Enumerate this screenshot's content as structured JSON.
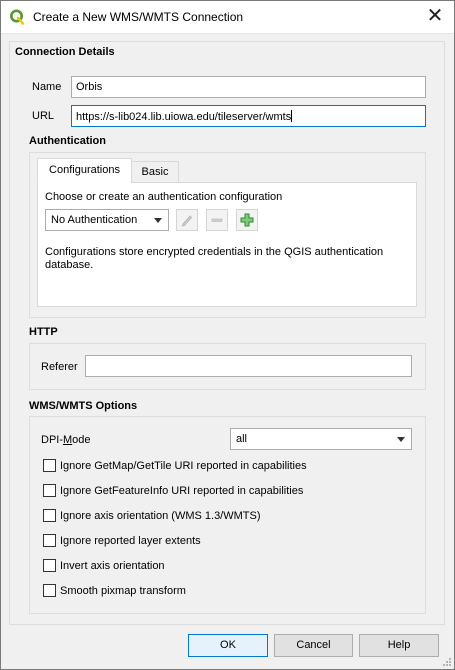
{
  "window": {
    "title": "Create a New WMS/WMTS Connection",
    "close_glyph": "✕"
  },
  "connection": {
    "section_title": "Connection Details",
    "name_label": "Name",
    "name_value": "Orbis",
    "url_label": "URL",
    "url_value": "https://s-lib024.lib.uiowa.edu/tileserver/wmts"
  },
  "authentication": {
    "section_title": "Authentication",
    "tabs": [
      {
        "label": "Configurations",
        "active": true
      },
      {
        "label": "Basic",
        "active": false
      }
    ],
    "choose_text": "Choose or create an authentication configuration",
    "selected_config": "No Authentication",
    "info_line1": "Configurations store encrypted credentials in the QGIS authentication",
    "info_line2": "database.",
    "icons": [
      "edit-pencil-icon",
      "remove-minus-icon",
      "add-plus-icon"
    ]
  },
  "http": {
    "section_title": "HTTP",
    "referer_label": "Referer",
    "referer_value": ""
  },
  "wms": {
    "section_title": "WMS/WMTS Options",
    "dpi_label_pre": "DPI-",
    "dpi_label_underline": "M",
    "dpi_label_post": "ode",
    "dpi_value": "all",
    "options": [
      {
        "label": "Ignore GetMap/GetTile URI reported in capabilities",
        "checked": false
      },
      {
        "label": "Ignore GetFeatureInfo URI reported in capabilities",
        "checked": false
      },
      {
        "label": "Ignore axis orientation (WMS 1.3/WMTS)",
        "checked": false
      },
      {
        "label": "Ignore reported layer extents",
        "checked": false
      },
      {
        "label": "Invert axis orientation",
        "checked": false
      },
      {
        "label": "Smooth pixmap transform",
        "checked": false
      }
    ]
  },
  "buttons": {
    "ok": "OK",
    "cancel": "Cancel",
    "help": "Help"
  },
  "colors": {
    "accent": "#0078d7",
    "qgis_green": "#589632",
    "qgis_yellow": "#eec90d",
    "add_green": "#2e8b2e"
  }
}
